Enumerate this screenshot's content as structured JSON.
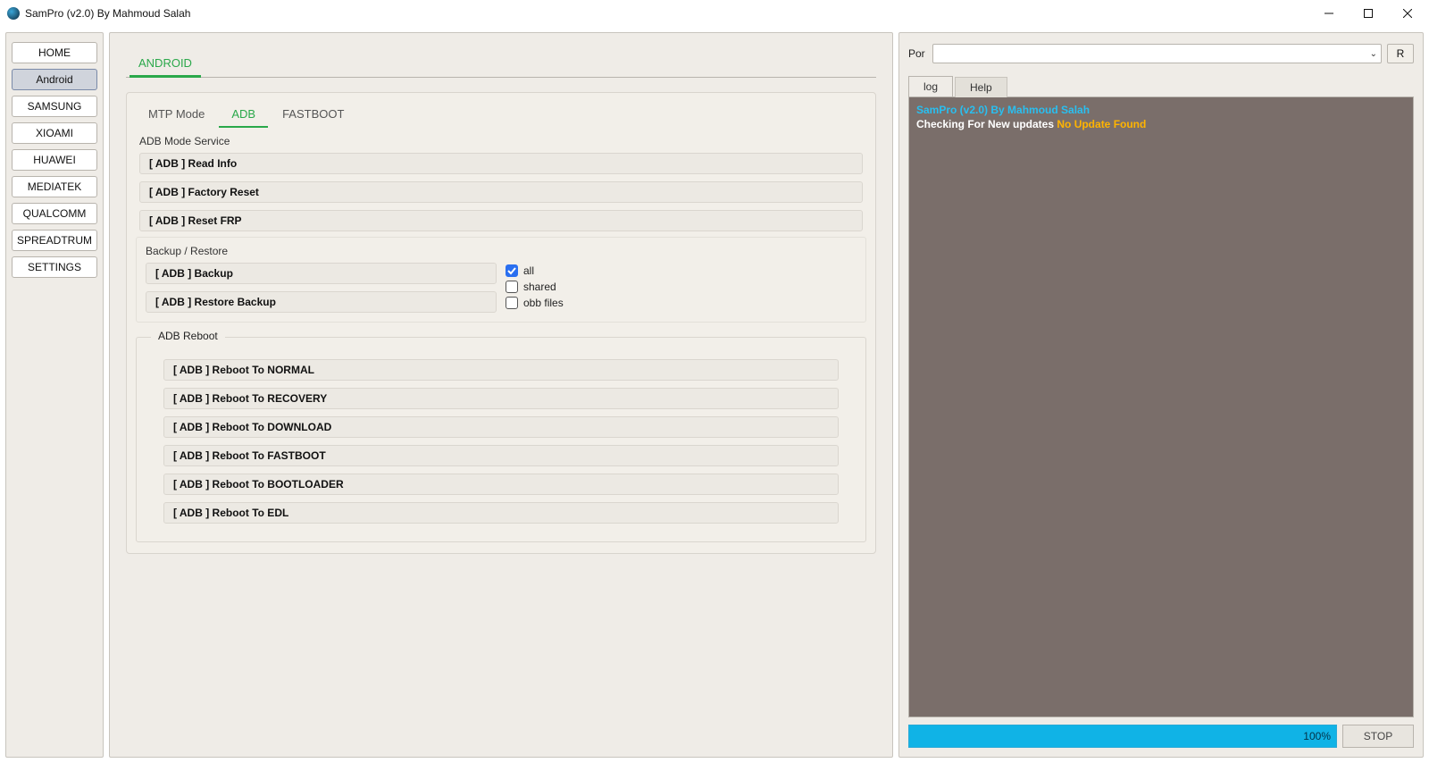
{
  "window": {
    "title": "SamPro (v2.0) By Mahmoud Salah"
  },
  "sidebar": {
    "items": [
      {
        "label": "HOME"
      },
      {
        "label": "Android",
        "active": true
      },
      {
        "label": "SAMSUNG"
      },
      {
        "label": "XIOAMI"
      },
      {
        "label": "HUAWEI"
      },
      {
        "label": "MEDIATEK"
      },
      {
        "label": "QUALCOMM"
      },
      {
        "label": "SPREADTRUM"
      },
      {
        "label": "SETTINGS"
      }
    ]
  },
  "main": {
    "tab": "ANDROID",
    "subtabs": [
      {
        "label": "MTP Mode"
      },
      {
        "label": "ADB",
        "active": true
      },
      {
        "label": "FASTBOOT"
      }
    ],
    "adbService": {
      "title": "ADB Mode Service",
      "items": [
        "[ ADB ] Read Info",
        "[ ADB ] Factory Reset",
        "[ ADB ] Reset FRP"
      ]
    },
    "backup": {
      "title": "Backup / Restore",
      "left": [
        "[ ADB ] Backup",
        "[ ADB ] Restore Backup"
      ],
      "checks": {
        "all": {
          "label": "all",
          "checked": true
        },
        "shared": {
          "label": "shared",
          "checked": false
        },
        "obb": {
          "label": "obb files",
          "checked": false
        }
      }
    },
    "reboot": {
      "legend": "ADB Reboot",
      "items": [
        "[ ADB ] Reboot To NORMAL",
        "[ ADB ] Reboot To RECOVERY",
        "[ ADB ] Reboot To DOWNLOAD",
        "[ ADB ] Reboot To FASTBOOT",
        "[ ADB ] Reboot To BOOTLOADER",
        "[ ADB ] Reboot To EDL"
      ]
    }
  },
  "right": {
    "portLabel": "Por",
    "portValue": "",
    "refresh": "R",
    "tabs": {
      "log": "log",
      "help": "Help"
    },
    "log": {
      "line1": "SamPro (v2.0) By Mahmoud Salah",
      "line2a": "Checking For New updates ",
      "line2b": "No Update Found"
    },
    "progressText": "100%",
    "stop": "STOP"
  }
}
